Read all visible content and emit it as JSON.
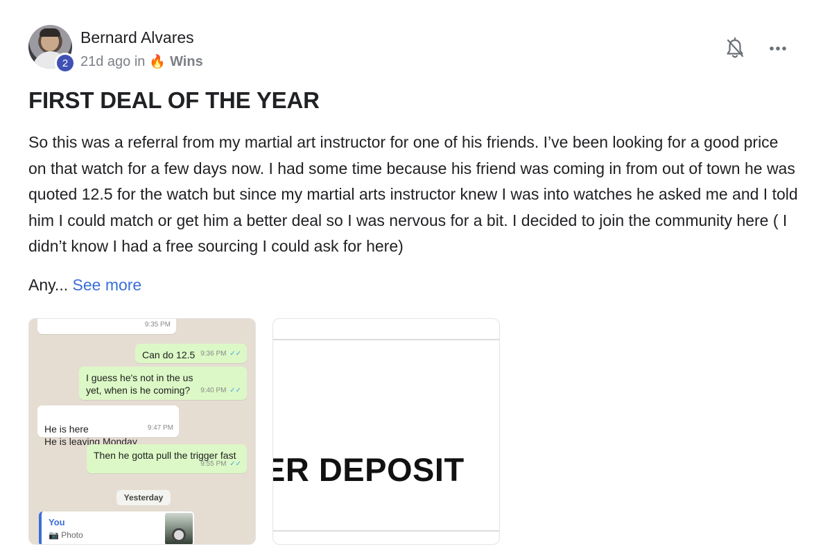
{
  "post": {
    "author": "Bernard Alvares",
    "level": "2",
    "time_ago": "21d ago in",
    "category_icon": "🔥",
    "category": "Wins",
    "title": "FIRST DEAL OF THE YEAR",
    "body": "So this was a referral from my martial art instructor for one of his friends. I’ve been looking for a good price on that watch for a few days now. I had some time because his friend was coming in from out of town he was quoted 12.5 for the watch but since my martial arts instructor knew I was into watches he asked me and I told him I could match or get him a better deal so I was nervous for a bit. I decided to join the community here ( I didn’t know I had a free sourcing I could ask for here)",
    "truncated": "Any...",
    "see_more": "See more"
  },
  "icons": {
    "bell": "bell-off-icon",
    "more": "more-horizontal-icon"
  },
  "attachments": {
    "chat": {
      "partial_top_time": "9:35 PM",
      "messages": [
        {
          "text": "Can do 12.5",
          "time": "9:36 PM",
          "ticks": "✓✓"
        },
        {
          "text": "I guess he's not in the us yet, when is he coming?",
          "time": "9:40 PM",
          "ticks": "✓✓"
        },
        {
          "text": "He is here\nHe is leaving Monday",
          "time": "9:47 PM",
          "ticks": ""
        },
        {
          "text": "Then he gotta pull the trigger fast",
          "time": "9:55 PM",
          "ticks": "✓✓"
        }
      ],
      "date_divider": "Yesterday",
      "reply_author": "You",
      "reply_type": "Photo"
    },
    "deposit": {
      "text": "ER DEPOSIT"
    }
  }
}
